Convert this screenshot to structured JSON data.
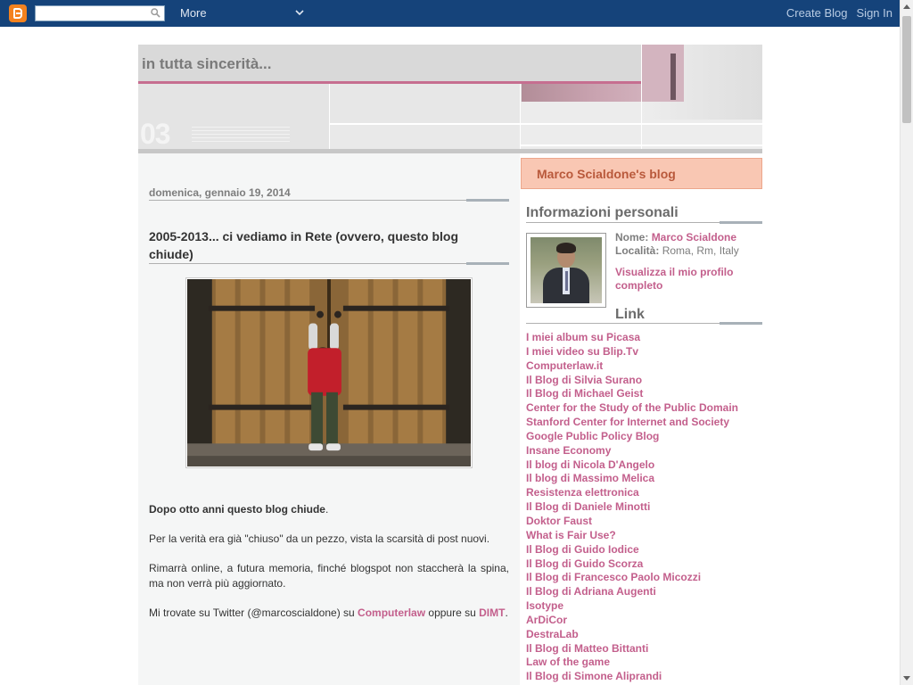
{
  "navbar": {
    "more_label": "More",
    "create_blog": "Create Blog",
    "sign_in": "Sign In",
    "search_value": ""
  },
  "header": {
    "title": "in tutta sincerità...",
    "number_graphic": "03"
  },
  "post": {
    "date": "domenica, gennaio 19, 2014",
    "title": "2005-2013... ci vediamo in Rete (ovvero, questo blog chiude)",
    "image_subject": "child-at-wooden-door",
    "p1_bold": "Dopo otto anni questo blog chiude",
    "p1_end": ".",
    "p2": "Per la verità era già \"chiuso\" da un pezzo, vista la scarsità di post nuovi.",
    "p3": "Rimarrà online, a futura memoria, finché blogspot non staccherà la spina, ma non verrà più aggiornato.",
    "p4_start": "Mi trovate su Twitter (@marcoscialdone) su ",
    "p4_link1": "Computerlaw",
    "p4_mid": " oppure su ",
    "p4_link2": "DIMT",
    "p4_end": "."
  },
  "sidebar": {
    "blog_title": "Marco Scialdone's blog",
    "about_heading": "Informazioni personali",
    "name_label": "Nome:",
    "name_value": "Marco Scialdone",
    "location_label": "Località:",
    "location_value": "Roma, Rm, Italy",
    "profile_link": "Visualizza il mio profilo completo",
    "links_heading": "Link",
    "links": [
      "I miei album su Picasa",
      "I miei video su Blip.Tv",
      "Computerlaw.it",
      "Il Blog di Silvia Surano",
      "Il Blog di Michael Geist",
      "Center for the Study of the Public Domain",
      "Stanford Center for Internet and Society",
      "Google Public Policy Blog",
      "Insane Economy",
      "Il blog di Nicola D'Angelo",
      "Il blog di Massimo Melica",
      "Resistenza elettronica",
      "Il Blog di Daniele Minotti",
      "Doktor Faust",
      "What is Fair Use?",
      "Il Blog di Guido Iodice",
      "Il Blog di Guido Scorza",
      "Il Blog di Francesco Paolo Micozzi",
      "Il Blog di Adriana Augenti",
      "Isotype",
      "ArDiCor",
      "DestraLab",
      "Il Blog di Matteo Bittanti",
      "Law of the game",
      "Il Blog di Simone Aliprandi"
    ]
  },
  "colors": {
    "navbar_bg": "#15437a",
    "link_pink": "#c35f8c",
    "title_box_bg": "#f9c7b3",
    "title_box_text": "#b9593b"
  }
}
